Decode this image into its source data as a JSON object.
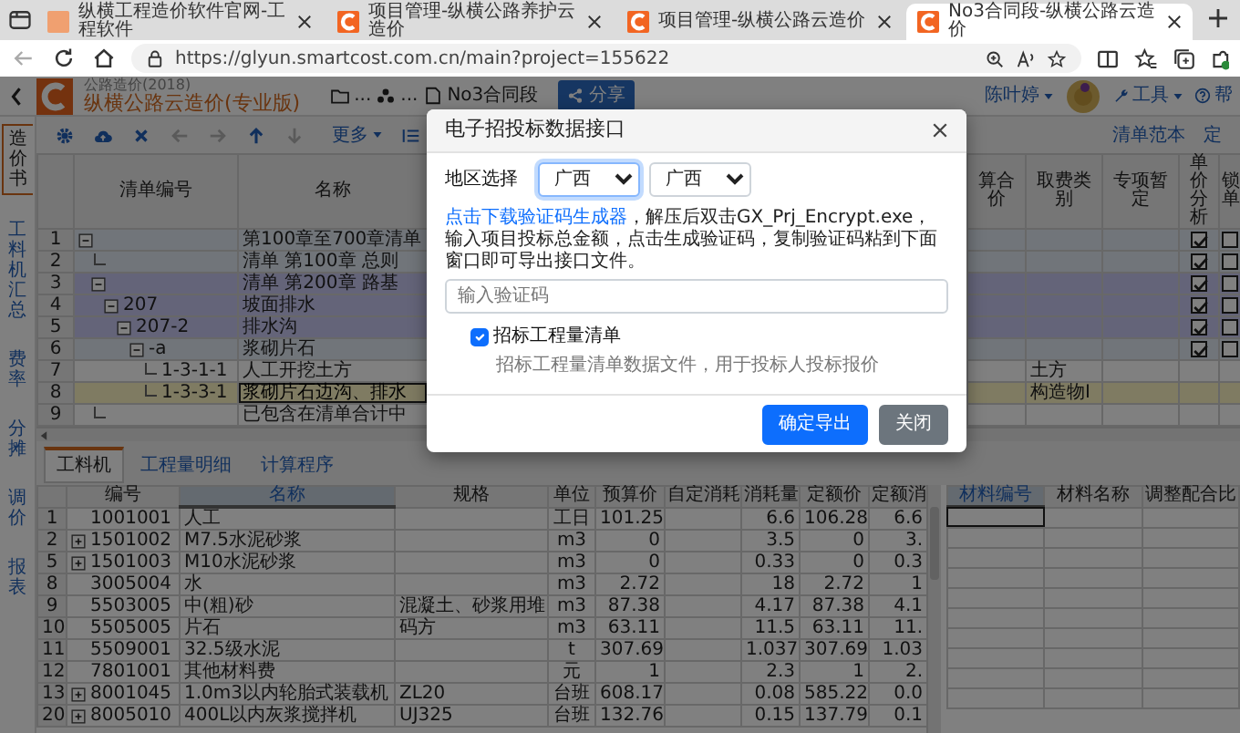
{
  "browser": {
    "tabs": [
      {
        "title": "纵横工程造价软件官网-工程软件",
        "kind": "plain",
        "selected": false
      },
      {
        "title": "项目管理-纵横公路养护云造价",
        "kind": "logo",
        "selected": false
      },
      {
        "title": "项目管理-纵横公路云造价",
        "kind": "logo",
        "selected": false
      },
      {
        "title": "No3合同段-纵横公路云造价",
        "kind": "logo",
        "selected": true
      }
    ],
    "url": "https://glyun.smartcost.com.cn/main?project=155622"
  },
  "app": {
    "product_year": "公路造价(2018)",
    "product_name": "纵横公路云造价(专业版)",
    "breadcrumb": [
      {
        "kind": "folder",
        "label": "..."
      },
      {
        "kind": "group",
        "label": "..."
      },
      {
        "kind": "file",
        "label": "No3合同段"
      }
    ],
    "share_button": "分享",
    "user": "陈叶婷",
    "tools_menu": "工具",
    "help_menu": "帮"
  },
  "side_tabs": [
    {
      "label": "造价书",
      "selected": true
    },
    {
      "label": "工料机汇总",
      "selected": false
    },
    {
      "label": "费率",
      "selected": false
    },
    {
      "label": "分摊",
      "selected": false
    },
    {
      "label": "调价",
      "selected": false
    },
    {
      "label": "报表",
      "selected": false
    }
  ],
  "toolbar": {
    "tools": [
      {
        "kind": "settings",
        "disabled": false
      },
      {
        "kind": "upload",
        "disabled": false
      },
      {
        "kind": "delete",
        "disabled": false
      },
      {
        "kind": "left",
        "disabled": true
      },
      {
        "kind": "right",
        "disabled": true
      },
      {
        "kind": "up",
        "disabled": false
      },
      {
        "kind": "down",
        "disabled": true
      }
    ],
    "more": "更多",
    "right_links": [
      "清单范本",
      "定"
    ]
  },
  "bill_table": {
    "columns": [
      "清单编号",
      "名称",
      "算合价",
      "取费类别",
      "专项暂定",
      "单价分析",
      "锁单"
    ],
    "rows": [
      {
        "num": "1",
        "name": "第100章至700章清单",
        "color": "#71757a",
        "selected": false,
        "price_analysis": true,
        "locked": false,
        "expanded": true,
        "children": [
          {
            "num": "2",
            "name": "清单 第100章 总则",
            "color": "#71757a",
            "selected": false,
            "price_analysis": true,
            "locked": false
          },
          {
            "num": "3",
            "name": "清单 第200章 路基",
            "color": "#646479",
            "selected": false,
            "price_analysis": true,
            "locked": false,
            "expanded": true,
            "children": [
              {
                "num": "4",
                "code": "207",
                "name": "坡面排水",
                "color": "#646479",
                "selected": false,
                "price_analysis": true,
                "locked": false,
                "expanded": true,
                "children": [
                  {
                    "num": "5",
                    "code": "207-2",
                    "name": "排水沟",
                    "color": "#646479",
                    "selected": false,
                    "price_analysis": true,
                    "locked": false,
                    "expanded": true,
                    "children": [
                      {
                        "num": "6",
                        "code": "-a",
                        "name": "浆砌片石",
                        "color": "#71757a",
                        "selected": false,
                        "price_analysis": true,
                        "locked": false,
                        "expanded": true,
                        "children": [
                          {
                            "num": "7",
                            "code": "1-3-1-1",
                            "name": "人工开挖土方",
                            "fee_type": "土方",
                            "color": "#808080",
                            "selected": false
                          },
                          {
                            "num": "8",
                            "code": "1-3-3-1",
                            "name": "浆砌片石边沟、排水",
                            "fee_type": "构造物I",
                            "color": "#7f7b62",
                            "selected": true
                          }
                        ]
                      }
                    ]
                  }
                ]
              }
            ]
          },
          {
            "num": "9",
            "name": "已包含在清单合计中",
            "color": "#808080",
            "selected": false
          }
        ]
      }
    ]
  },
  "lower_tabs": [
    {
      "label": "工料机",
      "selected": true
    },
    {
      "label": "工程量明细",
      "selected": false
    },
    {
      "label": "计算程序",
      "selected": false
    }
  ],
  "materials": {
    "columns": [
      {
        "label": "编号",
        "selected": false
      },
      {
        "label": "名称",
        "selected": true
      },
      {
        "label": "规格",
        "selected": false
      },
      {
        "label": "单位",
        "selected": false
      },
      {
        "label": "预算价",
        "selected": false
      },
      {
        "label": "自定消耗",
        "selected": false
      },
      {
        "label": "消耗量",
        "selected": false
      },
      {
        "label": "定额价",
        "selected": false
      },
      {
        "label": "定额消",
        "selected": false
      }
    ],
    "rows": [
      {
        "num": "1",
        "code": "1001001",
        "collapsed": false,
        "name": "人工",
        "unit": "工日",
        "price": "101.25",
        "consumption": "6.6",
        "quota_price": "106.28",
        "quota_consumption": "6.6"
      },
      {
        "num": "2",
        "code": "1501002",
        "collapsed": true,
        "name": "M7.5水泥砂浆",
        "unit": "m3",
        "price": "0",
        "consumption": "3.5",
        "quota_price": "0",
        "quota_consumption": "3."
      },
      {
        "num": "5",
        "code": "1501003",
        "collapsed": true,
        "name": "M10水泥砂浆",
        "unit": "m3",
        "price": "0",
        "consumption": "0.33",
        "quota_price": "0",
        "quota_consumption": "0.3"
      },
      {
        "num": "8",
        "code": "3005004",
        "collapsed": false,
        "name": "水",
        "unit": "m3",
        "price": "2.72",
        "consumption": "18",
        "quota_price": "2.72",
        "quota_consumption": "1"
      },
      {
        "num": "9",
        "code": "5503005",
        "collapsed": false,
        "name": "中(粗)砂",
        "spec": "混凝土、砂浆用堆",
        "unit": "m3",
        "price": "87.38",
        "consumption": "4.17",
        "quota_price": "87.38",
        "quota_consumption": "4.1"
      },
      {
        "num": "10",
        "code": "5505005",
        "collapsed": false,
        "name": "片石",
        "spec": "码方",
        "unit": "m3",
        "price": "63.11",
        "consumption": "11.5",
        "quota_price": "63.11",
        "quota_consumption": "11."
      },
      {
        "num": "11",
        "code": "5509001",
        "collapsed": false,
        "name": "32.5级水泥",
        "unit": "t",
        "price": "307.69",
        "consumption": "1.037",
        "quota_price": "307.69",
        "quota_consumption": "1.03"
      },
      {
        "num": "12",
        "code": "7801001",
        "collapsed": false,
        "name": "其他材料费",
        "unit": "元",
        "price": "1",
        "consumption": "2.3",
        "quota_price": "1",
        "quota_consumption": "2."
      },
      {
        "num": "13",
        "code": "8001045",
        "collapsed": true,
        "name": "1.0m3以内轮胎式装载机",
        "spec": "ZL20",
        "unit": "台班",
        "price": "608.17",
        "consumption": "0.08",
        "quota_price": "585.22",
        "quota_consumption": "0.0"
      },
      {
        "num": "20",
        "code": "8005010",
        "collapsed": true,
        "name": "400L以内灰浆搅拌机",
        "spec": "UJ325",
        "unit": "台班",
        "price": "132.76",
        "consumption": "0.15",
        "quota_price": "137.79",
        "quota_consumption": "0.1"
      }
    ]
  },
  "mix_table": {
    "columns": [
      {
        "label": "材料编号",
        "selected": true
      },
      {
        "label": "材料名称",
        "selected": false
      },
      {
        "label": "调整配合比",
        "selected": false
      }
    ]
  },
  "dialog": {
    "title": "电子招投标数据接口",
    "region_label": "地区选择",
    "region_selects": [
      {
        "value": "广西",
        "focused": true
      },
      {
        "value": "广西",
        "focused": false
      }
    ],
    "link": "点击下载验证码生成器",
    "instructions": "，解压后双击GX_Prj_Encrypt.exe，输入项目投标总金额，点击生成验证码，复制验证码粘到下面窗口即可导出接口文件。",
    "code_field": {
      "placeholder": "输入验证码"
    },
    "options": [
      {
        "label": "招标工程量清单",
        "checked": true,
        "hint": "招标工程量清单数据文件，用于投标人投标报价"
      }
    ],
    "buttons": [
      {
        "label": "确定导出",
        "kind": "primary"
      },
      {
        "label": "关闭",
        "kind": "secondary"
      }
    ]
  }
}
